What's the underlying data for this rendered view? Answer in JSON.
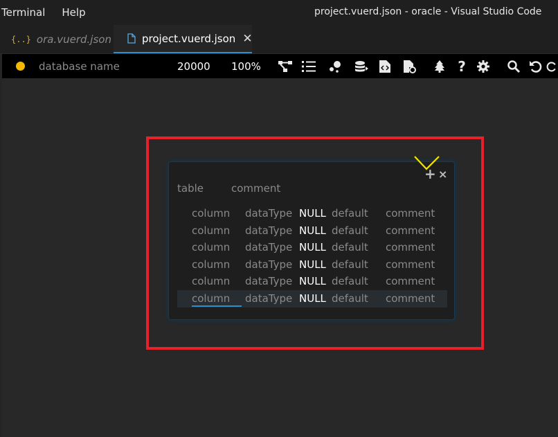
{
  "menu": [
    "Terminal",
    "Help"
  ],
  "window_title": "project.vuerd.json - oracle - Visual Studio Code",
  "tabs": [
    {
      "label": "ora.vuerd.json",
      "icon": "json-braces-icon",
      "active": false
    },
    {
      "label": "project.vuerd.json",
      "icon": "file-icon",
      "active": true
    }
  ],
  "toolbar": {
    "status_color": "#f5b800",
    "database_placeholder": "database name",
    "canvas_size": "20000",
    "zoom": "100%",
    "icons": [
      "relationship-icon",
      "list-icon",
      "visualization-icon",
      "database-stack-icon",
      "sql-file-icon",
      "file-settings-icon",
      "tree-icon",
      "help-icon",
      "settings-icon",
      "search-icon",
      "undo-icon",
      "redo-icon"
    ]
  },
  "table": {
    "name_placeholder": "table",
    "comment_placeholder": "comment",
    "columns": [
      {
        "name": "column",
        "dataType": "dataType",
        "null": "NULL",
        "default": "default",
        "comment": "comment"
      },
      {
        "name": "column",
        "dataType": "dataType",
        "null": "NULL",
        "default": "default",
        "comment": "comment"
      },
      {
        "name": "column",
        "dataType": "dataType",
        "null": "NULL",
        "default": "default",
        "comment": "comment"
      },
      {
        "name": "column",
        "dataType": "dataType",
        "null": "NULL",
        "default": "default",
        "comment": "comment"
      },
      {
        "name": "column",
        "dataType": "dataType",
        "null": "NULL",
        "default": "default",
        "comment": "comment"
      },
      {
        "name": "column",
        "dataType": "dataType",
        "null": "NULL",
        "default": "default",
        "comment": "comment"
      }
    ],
    "add_icon": "+",
    "close_icon": "×"
  },
  "colors": {
    "highlight": "#e8202a",
    "accent": "#2a8fce",
    "annotation_mark": "#f2e600"
  }
}
